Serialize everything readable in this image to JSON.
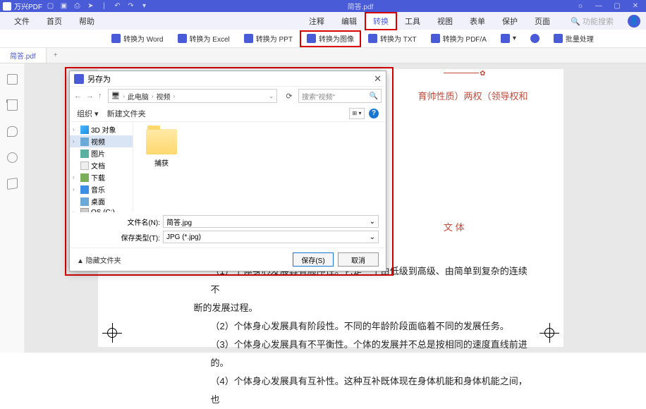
{
  "titlebar": {
    "app": "万兴PDF",
    "doc": "简答.pdf"
  },
  "menubar": {
    "file": "文件",
    "home": "首页",
    "help": "帮助",
    "annotate": "注释",
    "edit": "编辑",
    "convert": "转换",
    "tools": "工具",
    "view": "视图",
    "form": "表单",
    "protect": "保护",
    "page": "页面",
    "search_ph": "功能搜索"
  },
  "toolbar": {
    "word": "转换为 Word",
    "excel": "转换为 Excel",
    "ppt": "转换为 PPT",
    "image": "转换为图像",
    "txt": "转换为 TXT",
    "pdfa": "转换为 PDF/A",
    "batch": "批量处理"
  },
  "tab": {
    "name": "简答.pdf",
    "plus": "+"
  },
  "document": {
    "redfrag": "育帅性质）两权（领导权和",
    "redfrag2": "文 体",
    "p1": "（1）个体身心发展具有顺序性。它是一个由低级到高级、由简单到复杂的连续不",
    "p1b": "断的发展过程。",
    "p2": "（2）个体身心发展具有阶段性。不同的年龄阶段面临着不同的发展任务。",
    "p3": "（3）个体身心发展具有不平衡性。个体的发展并不总是按相同的速度直线前进的。",
    "p4": "（4）个体身心发展具有互补性。这种互补既体现在身体机能和身体机能之间，也"
  },
  "dialog": {
    "title": "另存为",
    "bc": {
      "root": "此电脑",
      "folder": "视频"
    },
    "search_ph": "搜索\"视频\"",
    "org": "组织 ▾",
    "newfolder": "新建文件夹",
    "tree": {
      "d3": "3D 对象",
      "video": "视频",
      "pic": "图片",
      "doc": "文档",
      "dl": "下载",
      "music": "音乐",
      "desk": "桌面",
      "osc": "OS (C:)"
    },
    "folder_item": "捕获",
    "filename_lbl": "文件名(N):",
    "filename": "简答.jpg",
    "savetype_lbl": "保存类型(T):",
    "savetype": "JPG (*.jpg)",
    "hide": "▲ 隐藏文件夹",
    "save": "保存(S)",
    "cancel": "取消"
  }
}
